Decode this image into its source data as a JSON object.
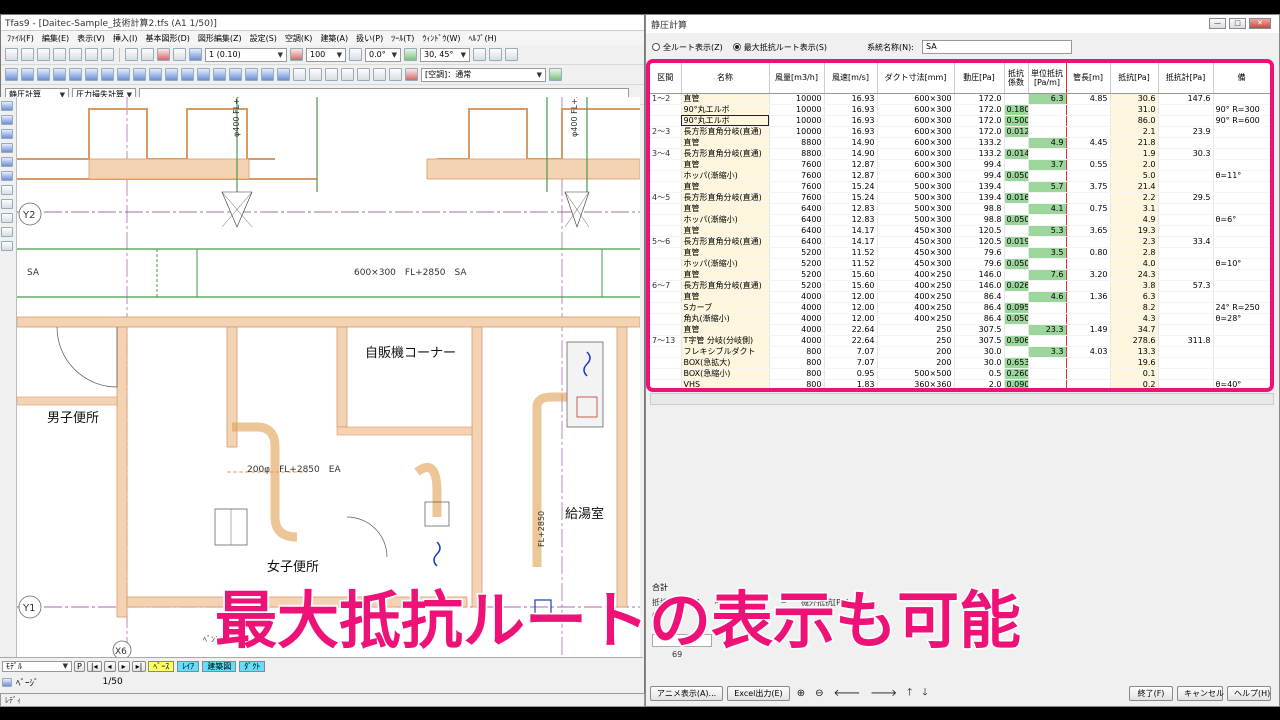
{
  "app": {
    "title": "Tfas9 - [Daitec-Sample_技術計算2.tfs (A1 1/50)]",
    "menu": [
      "ﾌｧｲﾙ(F)",
      "編集(E)",
      "表示(V)",
      "挿入(I)",
      "基本図形(D)",
      "図形編集(Z)",
      "設定(S)",
      "空調(K)",
      "建築(A)",
      "扱い(P)",
      "ﾂｰﾙ(T)",
      "ｳｨﾝﾄﾞｳ(W)",
      "ﾍﾙﾌﾟ(H)"
    ],
    "scale_combo": "1 (0.10)",
    "zoom_combo": "100",
    "angle_combo": "0.0°",
    "snap_combo": "30, 45°",
    "system_combo": "[空調]：通常",
    "mode_combo": "静圧計算",
    "mode_combo2": "圧力損失計算",
    "layer_combo": "ﾓﾃﾞﾙ",
    "layer_tabs": [
      "ﾍﾞｰｽ",
      "ﾚｲｱ",
      "建築図",
      "ﾀﾞｸﾄ"
    ],
    "page_label": "ﾍﾞｰｼﾞ",
    "page_count": "1/50",
    "status": "ﾚﾃﾞｨ",
    "P_label": "P"
  },
  "drawing": {
    "grid_y2": "Y2",
    "grid_y1": "Y1",
    "grid_x6": "X6",
    "duct_label_main": "600×300　FL+2850　SA",
    "duct_label_sa": "SA",
    "duct_label_v1": "φ400 FL+3000 SA",
    "duct_label_v2": "φ400 FL+3000 SA",
    "duct_label_ea": "200φ　FL+2850　EA",
    "duct_label_fl": "FL+2850",
    "room_vending": "自販機コーナー",
    "room_mens": "男子便所",
    "room_womens": "女子便所",
    "room_kitchen": "給湯室",
    "label_bent": "ﾍﾞﾝﾄｷ"
  },
  "dialog": {
    "title": "静圧計算",
    "radio_all": "全ルート表示(Z)",
    "radio_max": "最大抵抗ルート表示(S)",
    "system_label": "系統名称(N):",
    "system_value": "SA",
    "columns": [
      "区間",
      "名称",
      "風量[m3/h]",
      "風速[m/s]",
      "ダクト寸法[mm]",
      "動圧[Pa]",
      "抵抗係数",
      "単位抵抗[Pa/m]",
      "管長[m]",
      "抵抗[Pa]",
      "抵抗計[Pa]",
      "備"
    ],
    "rows": [
      {
        "sec": "1～2",
        "name": "直管",
        "q": "10000",
        "v": "16.93",
        "size": "600×300",
        "pd": "172.0",
        "k": "",
        "r": "6.3",
        "l": "4.85",
        "res": "30.6",
        "sum": "147.6",
        "note": ""
      },
      {
        "sec": "",
        "name": "90°丸エルボ",
        "q": "10000",
        "v": "16.93",
        "size": "600×300",
        "pd": "172.0",
        "k": "0.180",
        "r": "",
        "l": "",
        "res": "31.0",
        "sum": "",
        "note": "90° R=300"
      },
      {
        "sec": "",
        "name": "90°丸エルボ",
        "q": "10000",
        "v": "16.93",
        "size": "600×300",
        "pd": "172.0",
        "k": "0.500",
        "r": "",
        "l": "",
        "res": "86.0",
        "sum": "",
        "note": "90° R=600",
        "sel": true
      },
      {
        "sec": "2～3",
        "name": "長方形直角分岐(直通)",
        "q": "10000",
        "v": "16.93",
        "size": "600×300",
        "pd": "172.0",
        "k": "0.012",
        "r": "",
        "l": "",
        "res": "2.1",
        "sum": "23.9",
        "note": ""
      },
      {
        "sec": "",
        "name": "直管",
        "q": "8800",
        "v": "14.90",
        "size": "600×300",
        "pd": "133.2",
        "k": "",
        "r": "4.9",
        "l": "4.45",
        "res": "21.8",
        "sum": "",
        "note": ""
      },
      {
        "sec": "3～4",
        "name": "長方形直角分岐(直通)",
        "q": "8800",
        "v": "14.90",
        "size": "600×300",
        "pd": "133.2",
        "k": "0.014",
        "r": "",
        "l": "",
        "res": "1.9",
        "sum": "30.3",
        "note": ""
      },
      {
        "sec": "",
        "name": "直管",
        "q": "7600",
        "v": "12.87",
        "size": "600×300",
        "pd": "99.4",
        "k": "",
        "r": "3.7",
        "l": "0.55",
        "res": "2.0",
        "sum": "",
        "note": ""
      },
      {
        "sec": "",
        "name": "ホッパ(漸縮小)",
        "q": "7600",
        "v": "12.87",
        "size": "600×300",
        "pd": "99.4",
        "k": "0.050",
        "r": "",
        "l": "",
        "res": "5.0",
        "sum": "",
        "note": "θ=11°"
      },
      {
        "sec": "",
        "name": "直管",
        "q": "7600",
        "v": "15.24",
        "size": "500×300",
        "pd": "139.4",
        "k": "",
        "r": "5.7",
        "l": "3.75",
        "res": "21.4",
        "sum": "",
        "note": ""
      },
      {
        "sec": "4～5",
        "name": "長方形直角分岐(直通)",
        "q": "7600",
        "v": "15.24",
        "size": "500×300",
        "pd": "139.4",
        "k": "0.016",
        "r": "",
        "l": "",
        "res": "2.2",
        "sum": "29.5",
        "note": ""
      },
      {
        "sec": "",
        "name": "直管",
        "q": "6400",
        "v": "12.83",
        "size": "500×300",
        "pd": "98.8",
        "k": "",
        "r": "4.1",
        "l": "0.75",
        "res": "3.1",
        "sum": "",
        "note": ""
      },
      {
        "sec": "",
        "name": "ホッパ(漸縮小)",
        "q": "6400",
        "v": "12.83",
        "size": "500×300",
        "pd": "98.8",
        "k": "0.050",
        "r": "",
        "l": "",
        "res": "4.9",
        "sum": "",
        "note": "θ=6°"
      },
      {
        "sec": "",
        "name": "直管",
        "q": "6400",
        "v": "14.17",
        "size": "450×300",
        "pd": "120.5",
        "k": "",
        "r": "5.3",
        "l": "3.65",
        "res": "19.3",
        "sum": "",
        "note": ""
      },
      {
        "sec": "5～6",
        "name": "長方形直角分岐(直通)",
        "q": "6400",
        "v": "14.17",
        "size": "450×300",
        "pd": "120.5",
        "k": "0.019",
        "r": "",
        "l": "",
        "res": "2.3",
        "sum": "33.4",
        "note": ""
      },
      {
        "sec": "",
        "name": "直管",
        "q": "5200",
        "v": "11.52",
        "size": "450×300",
        "pd": "79.6",
        "k": "",
        "r": "3.5",
        "l": "0.80",
        "res": "2.8",
        "sum": "",
        "note": ""
      },
      {
        "sec": "",
        "name": "ホッパ(漸縮小)",
        "q": "5200",
        "v": "11.52",
        "size": "450×300",
        "pd": "79.6",
        "k": "0.050",
        "r": "",
        "l": "",
        "res": "4.0",
        "sum": "",
        "note": "θ=10°"
      },
      {
        "sec": "",
        "name": "直管",
        "q": "5200",
        "v": "15.60",
        "size": "400×250",
        "pd": "146.0",
        "k": "",
        "r": "7.6",
        "l": "3.20",
        "res": "24.3",
        "sum": "",
        "note": ""
      },
      {
        "sec": "6～7",
        "name": "長方形直角分岐(直通)",
        "q": "5200",
        "v": "15.60",
        "size": "400×250",
        "pd": "146.0",
        "k": "0.026",
        "r": "",
        "l": "",
        "res": "3.8",
        "sum": "57.3",
        "note": ""
      },
      {
        "sec": "",
        "name": "直管",
        "q": "4000",
        "v": "12.00",
        "size": "400×250",
        "pd": "86.4",
        "k": "",
        "r": "4.6",
        "l": "1.36",
        "res": "6.3",
        "sum": "",
        "note": ""
      },
      {
        "sec": "",
        "name": "Sカーブ",
        "q": "4000",
        "v": "12.00",
        "size": "400×250",
        "pd": "86.4",
        "k": "0.095",
        "r": "",
        "l": "",
        "res": "8.2",
        "sum": "",
        "note": "24° R=250"
      },
      {
        "sec": "",
        "name": "角丸(漸縮小)",
        "q": "4000",
        "v": "12.00",
        "size": "400×250",
        "pd": "86.4",
        "k": "0.050",
        "r": "",
        "l": "",
        "res": "4.3",
        "sum": "",
        "note": "θ=28°"
      },
      {
        "sec": "",
        "name": "直管",
        "q": "4000",
        "v": "22.64",
        "size": "250",
        "pd": "307.5",
        "k": "",
        "r": "23.3",
        "l": "1.49",
        "res": "34.7",
        "sum": "",
        "note": ""
      },
      {
        "sec": "7～13",
        "name": "T字管 分岐(分岐側)",
        "q": "4000",
        "v": "22.64",
        "size": "250",
        "pd": "307.5",
        "k": "0.906",
        "r": "",
        "l": "",
        "res": "278.6",
        "sum": "311.8",
        "note": ""
      },
      {
        "sec": "",
        "name": "フレキシブルダクト",
        "q": "800",
        "v": "7.07",
        "size": "200",
        "pd": "30.0",
        "k": "",
        "r": "3.3",
        "l": "4.03",
        "res": "13.3",
        "sum": "",
        "note": ""
      },
      {
        "sec": "",
        "name": "BOX(急拡大)",
        "q": "800",
        "v": "7.07",
        "size": "200",
        "pd": "30.0",
        "k": "0.653",
        "r": "",
        "l": "",
        "res": "19.6",
        "sum": "",
        "note": ""
      },
      {
        "sec": "",
        "name": "BOX(急縮小)",
        "q": "800",
        "v": "0.95",
        "size": "500×500",
        "pd": "0.5",
        "k": "0.260",
        "r": "",
        "l": "",
        "res": "0.1",
        "sum": "",
        "note": ""
      },
      {
        "sec": "",
        "name": "VHS",
        "q": "800",
        "v": "1.83",
        "size": "360×360",
        "pd": "2.0",
        "k": "0.090",
        "r": "",
        "l": "",
        "res": "0.2",
        "sum": "",
        "note": "θ=40°"
      }
    ],
    "summary_title": "合計",
    "summary_items": [
      "抵抗合計[Pa]",
      "×",
      "余裕係数",
      "=",
      "機外抵抗[Pa]"
    ],
    "summary_v1": "67",
    "summary_v2": "69",
    "buttons": {
      "anime": "アニメ表示(A)...",
      "excel": "Excel出力(E)",
      "finish": "終了(F)",
      "cancel": "キャンセル",
      "help": "ヘルプ(H)"
    }
  },
  "caption": "最大抵抗ルートの表示も可能"
}
